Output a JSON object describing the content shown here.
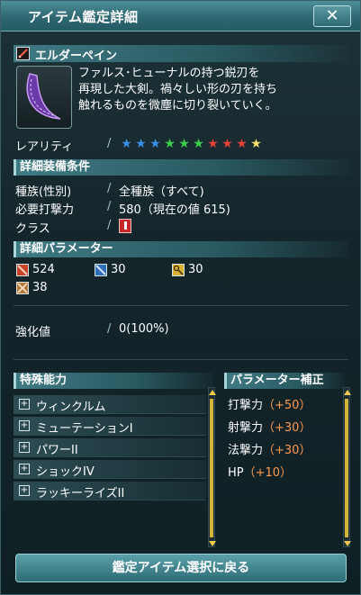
{
  "window": {
    "title": "アイテム鑑定詳細",
    "close_label": "✕"
  },
  "item": {
    "name": "エルダーペイン",
    "description_lines": [
      "ファルス･ヒューナルの持つ鋭刃を",
      "再現した大剣。禍々しい形の刃を持ち",
      "触れるものを微塵に切り裂いていく。"
    ]
  },
  "rarity": {
    "label": "レアリティ",
    "stars": [
      {
        "color": "#3a8fe6"
      },
      {
        "color": "#3a8fe6"
      },
      {
        "color": "#3a8fe6"
      },
      {
        "color": "#3bd24a"
      },
      {
        "color": "#3bd24a"
      },
      {
        "color": "#3bd24a"
      },
      {
        "color": "#e8433a"
      },
      {
        "color": "#e8433a"
      },
      {
        "color": "#e8433a"
      },
      {
        "color": "#f5e26a"
      }
    ]
  },
  "equip_conditions": {
    "header": "詳細装備条件",
    "race_label": "種族(性別)",
    "race_value": "全種族（すべて)",
    "attack_label": "必要打撃力",
    "attack_value": "580（現在の値 615)",
    "class_label": "クラス"
  },
  "parameters": {
    "header": "詳細パラメーター",
    "melee": "524",
    "ranged": "30",
    "technique": "30",
    "other": "38"
  },
  "grind": {
    "label": "強化値",
    "value": "0(100%)"
  },
  "abilities": {
    "header": "特殊能力",
    "items": [
      "ウィンクルム",
      "ミューテーションI",
      "パワーII",
      "ショックIV",
      "ラッキーライズII"
    ]
  },
  "param_bonus": {
    "header": "パラメーター補正",
    "items": [
      {
        "label": "打撃力",
        "value": "（+50）"
      },
      {
        "label": "射撃力",
        "value": "（+30）"
      },
      {
        "label": "法撃力",
        "value": "（+30）"
      },
      {
        "label": "HP",
        "value": "（+10）"
      }
    ]
  },
  "footer": {
    "button_label": "鑑定アイテム選択に戻る"
  }
}
